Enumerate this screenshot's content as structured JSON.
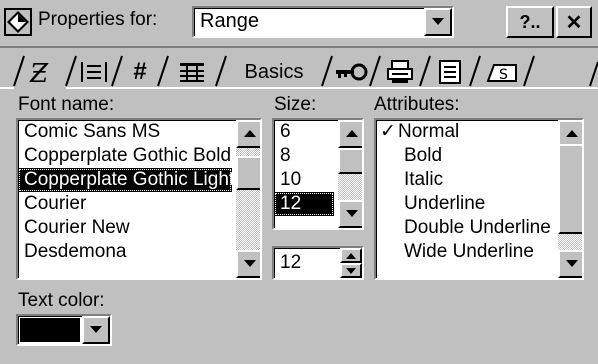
{
  "dialog": {
    "title_label": "Properties for:",
    "object_value": "Range",
    "help_label": "?..",
    "close_label": "✕"
  },
  "tabs": [
    {
      "label": "",
      "icon": "font-style-icon"
    },
    {
      "label": "",
      "icon": "alignment-icon"
    },
    {
      "label": "#",
      "icon": "number-format-icon"
    },
    {
      "label": "",
      "icon": "grid-lines-icon"
    },
    {
      "label": "Basics",
      "icon": ""
    },
    {
      "label": "",
      "icon": "key-icon"
    },
    {
      "label": "",
      "icon": "printer-icon"
    },
    {
      "label": "",
      "icon": "page-icon"
    },
    {
      "label": "",
      "icon": "cell-icon"
    }
  ],
  "font": {
    "label": "Font name:",
    "items": [
      "Comic Sans MS",
      "Copperplate Gothic Bold",
      "Copperplate Gothic Light",
      "Courier",
      "Courier New",
      "Desdemona"
    ],
    "selected": "Copperplate Gothic Light"
  },
  "size": {
    "label": "Size:",
    "items": [
      "6",
      "8",
      "10",
      "12"
    ],
    "selected": "12",
    "spinner_value": "12"
  },
  "attributes": {
    "label": "Attributes:",
    "items": [
      "Normal",
      "Bold",
      "Italic",
      "Underline",
      "Double Underline",
      "Wide Underline"
    ],
    "checked": "Normal"
  },
  "text_color": {
    "label": "Text color:",
    "value_color": "#000000"
  }
}
